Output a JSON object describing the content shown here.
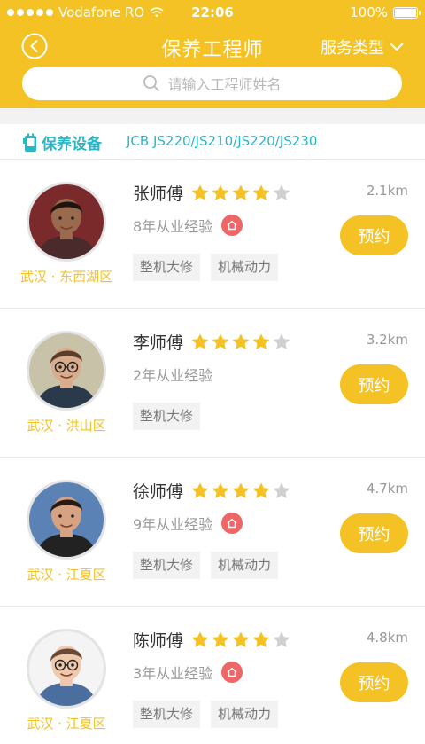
{
  "status_bar": {
    "carrier": "Vodafone RO",
    "time": "22:06",
    "battery": "100%"
  },
  "nav": {
    "title": "保养工程师",
    "filter_label": "服务类型"
  },
  "search": {
    "placeholder": "请输入工程师姓名"
  },
  "equipment": {
    "label": "保养设备",
    "models": "JCB JS220/JS210/JS220/JS230"
  },
  "engineers": [
    {
      "name": "张师傅",
      "rating": 4,
      "experience": "8年从业经验",
      "home_badge": true,
      "tags": [
        "整机大修",
        "机械动力"
      ],
      "distance": "2.1km",
      "location": "武汉 · 东西湖区",
      "book_label": "预约",
      "avatar": {
        "skin": "#9a6a4e",
        "hair": "#1e1410",
        "bg": "#7a2a2a",
        "shirt": "#4a2a2a",
        "glasses": false
      }
    },
    {
      "name": "李师傅",
      "rating": 4,
      "experience": "2年从业经验",
      "home_badge": false,
      "tags": [
        "整机大修"
      ],
      "distance": "3.2km",
      "location": "武汉 · 洪山区",
      "book_label": "预约",
      "avatar": {
        "skin": "#d8ac8c",
        "hair": "#5a3e2a",
        "bg": "#c8c2a8",
        "shirt": "#2b3a4a",
        "glasses": true
      }
    },
    {
      "name": "徐师傅",
      "rating": 4,
      "experience": "9年从业经验",
      "home_badge": true,
      "tags": [
        "整机大修",
        "机械动力"
      ],
      "distance": "4.7km",
      "location": "武汉 · 江夏区",
      "book_label": "预约",
      "avatar": {
        "skin": "#d6a282",
        "hair": "#2a1a12",
        "bg": "#5a82b4",
        "shirt": "#222222",
        "glasses": false
      }
    },
    {
      "name": "陈师傅",
      "rating": 4,
      "experience": "3年从业经验",
      "home_badge": true,
      "tags": [
        "整机大修",
        "机械动力"
      ],
      "distance": "4.8km",
      "location": "武汉 · 江夏区",
      "book_label": "预约",
      "avatar": {
        "skin": "#f0c8ac",
        "hair": "#6a4a34",
        "bg": "#f4f4f4",
        "shirt": "#4a6e9e",
        "glasses": true
      }
    }
  ],
  "colors": {
    "accent": "#F4C224",
    "teal": "#29b6c6",
    "badge_red": "#EE6666",
    "star_off": "#d0d0d0"
  }
}
